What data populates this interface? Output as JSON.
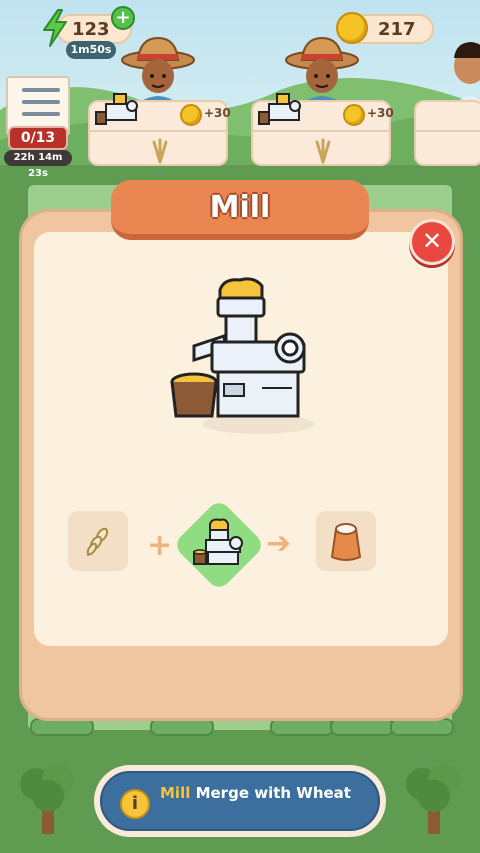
{
  "hud": {
    "energy": "123",
    "energy_timer": "1m50s",
    "coins": "217",
    "quest_count": "0/13",
    "quest_timer": "22h 14m 23s"
  },
  "customers": [
    {
      "reward": "+30"
    },
    {
      "reward": "+30"
    }
  ],
  "modal": {
    "title": "Mill",
    "close_label": "✕"
  },
  "recipe": {
    "plus": "+",
    "arrow": "➔"
  },
  "hint": {
    "keyword": "Mill",
    "text": " Merge with Wheat",
    "icon": "i"
  },
  "colors": {
    "accent_orange": "#ea8652",
    "close_red": "#e9483f",
    "hint_blue": "#3c6f9e",
    "coin_gold": "#f4c325"
  },
  "icons": [
    "lightning-icon",
    "plus-icon",
    "coin-icon",
    "checklist-icon",
    "close-icon",
    "wheat-icon",
    "mill-icon",
    "flour-sack-icon",
    "info-icon"
  ]
}
